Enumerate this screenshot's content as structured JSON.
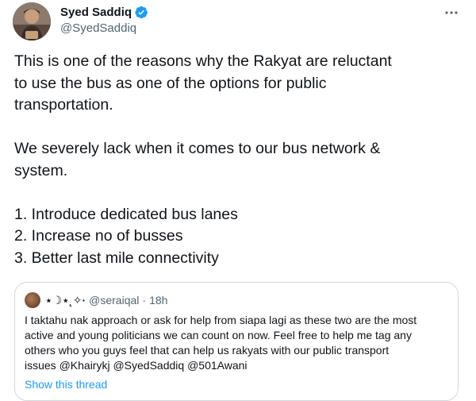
{
  "author": {
    "display_name": "Syed Saddiq",
    "handle": "@SyedSaddiq",
    "verified": true
  },
  "icons": {
    "more": "more-horizontal-icon",
    "verified": "verified-badge-icon"
  },
  "colors": {
    "accent": "#1d9bf0",
    "text": "#0f1419",
    "secondary": "#536471",
    "border": "#cfd9de"
  },
  "tweet": {
    "paragraph1_line1": "This is one of the reasons why the Rakyat are reluctant",
    "paragraph1_line2": "to use the bus as one of the options for public",
    "paragraph1_line3": "transportation.",
    "paragraph2_line1": "We severely lack when it comes to our bus network &",
    "paragraph2_line2": "system.",
    "list": [
      "1. Introduce dedicated bus lanes",
      "2. Increase no of busses",
      "3. Better last mile connectivity"
    ]
  },
  "quote": {
    "display_name": "⋆☽⋆˛✧·",
    "handle": "@seraiqal",
    "separator": "·",
    "time": "18h",
    "line1": "I taktahu nak approach or ask for help from siapa lagi as these two are the most",
    "line2": "active and young politicians we can count on now. Feel free to help me tag any",
    "line3": "others who you guys feel that can help us rakyats with our public transport",
    "line4": "issues @Khairykj @SyedSaddiq @501Awani",
    "show_thread": "Show this thread"
  }
}
